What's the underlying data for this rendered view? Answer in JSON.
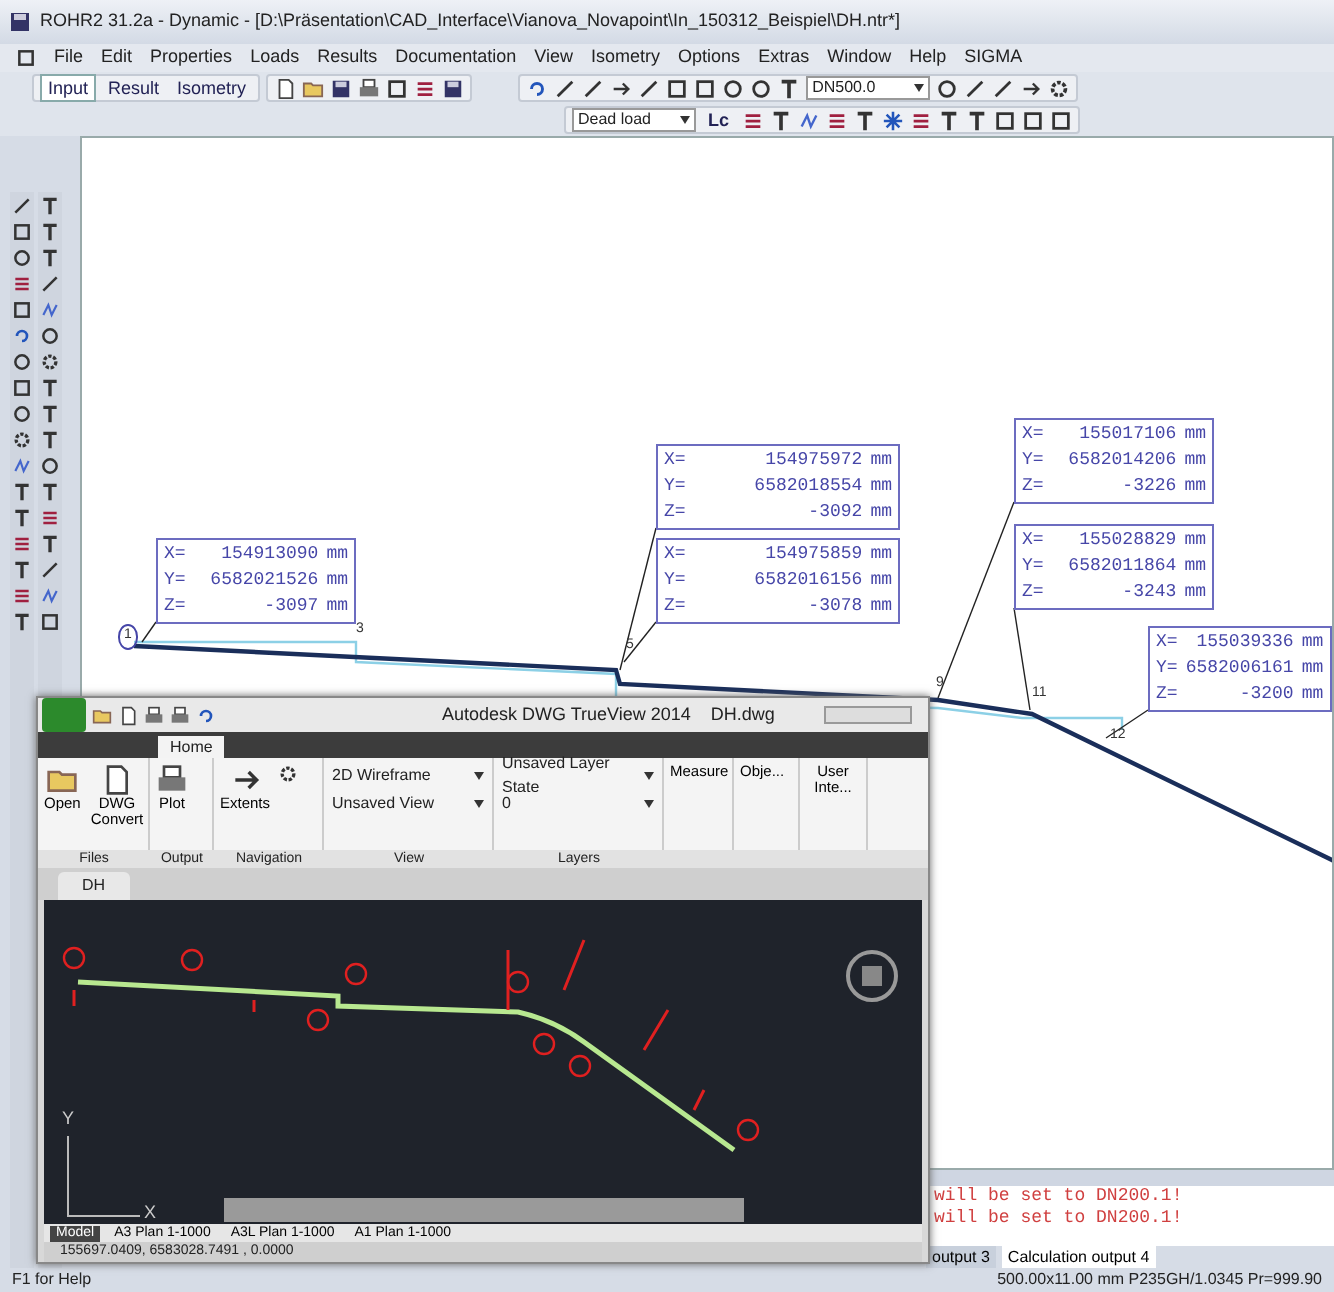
{
  "window": {
    "title": "ROHR2 31.2a - Dynamic - [D:\\Präsentation\\CAD_Interface\\Vianova_Novapoint\\In_150312_Beispiel\\DH.ntr*]"
  },
  "menu": [
    "File",
    "Edit",
    "Properties",
    "Loads",
    "Results",
    "Documentation",
    "View",
    "Isometry",
    "Options",
    "Extras",
    "Window",
    "Help",
    "SIGMA"
  ],
  "mode_tabs": [
    {
      "label": "Input",
      "selected": true
    },
    {
      "label": "Result",
      "selected": false
    },
    {
      "label": "Isometry",
      "selected": false
    }
  ],
  "toolbar": {
    "nominal_diameter": "DN500.0",
    "load_case": "Dead load",
    "load_case_button": "Lc"
  },
  "coordinate_labels": [
    {
      "rows": [
        {
          "axis": "X=",
          "value": "154913090",
          "unit": "mm"
        },
        {
          "axis": "Y=",
          "value": "6582021526",
          "unit": "mm"
        },
        {
          "axis": "Z=",
          "value": "-3097",
          "unit": "mm"
        }
      ]
    },
    {
      "rows": [
        {
          "axis": "X=",
          "value": "154975972",
          "unit": "mm"
        },
        {
          "axis": "Y=",
          "value": "6582018554",
          "unit": "mm"
        },
        {
          "axis": "Z=",
          "value": "-3092",
          "unit": "mm"
        }
      ]
    },
    {
      "rows": [
        {
          "axis": "X=",
          "value": "154975859",
          "unit": "mm"
        },
        {
          "axis": "Y=",
          "value": "6582016156",
          "unit": "mm"
        },
        {
          "axis": "Z=",
          "value": "-3078",
          "unit": "mm"
        }
      ]
    },
    {
      "rows": [
        {
          "axis": "X=",
          "value": "155017106",
          "unit": "mm"
        },
        {
          "axis": "Y=",
          "value": "6582014206",
          "unit": "mm"
        },
        {
          "axis": "Z=",
          "value": "-3226",
          "unit": "mm"
        }
      ]
    },
    {
      "rows": [
        {
          "axis": "X=",
          "value": "155028829",
          "unit": "mm"
        },
        {
          "axis": "Y=",
          "value": "6582011864",
          "unit": "mm"
        },
        {
          "axis": "Z=",
          "value": "-3243",
          "unit": "mm"
        }
      ]
    },
    {
      "rows": [
        {
          "axis": "X=",
          "value": "155039336",
          "unit": "mm"
        },
        {
          "axis": "Y=",
          "value": "6582006161",
          "unit": "mm"
        },
        {
          "axis": "Z=",
          "value": "-3200",
          "unit": "mm"
        }
      ]
    }
  ],
  "node_labels": [
    "1",
    "3",
    "5",
    "9",
    "11",
    "12"
  ],
  "output": {
    "lines": [
      "will be set to DN200.1!",
      "will be set to DN200.1!"
    ],
    "tabs": [
      {
        "label": "output 3",
        "selected": false
      },
      {
        "label": "Calculation output 4",
        "selected": true
      }
    ]
  },
  "status_bar": {
    "help": "F1 for Help",
    "info": "500.00x11.00 mm P235GH/1.0345 Pr=999.90"
  },
  "trueview": {
    "title": "Autodesk DWG TrueView 2014",
    "document": "DH.dwg",
    "ribbon_tabs": [
      {
        "label": "Home",
        "selected": true
      }
    ],
    "buttons": [
      "Open",
      "DWG Convert",
      "Plot",
      "Extents"
    ],
    "dropdowns": [
      "2D Wireframe",
      "Unsaved View",
      "Unsaved Layer State",
      "0"
    ],
    "right_buttons": [
      "Measure",
      "Obje...",
      "User Inte..."
    ],
    "panels": [
      "Files",
      "Output",
      "Navigation",
      "View",
      "Layers"
    ],
    "doc_tab": "DH",
    "ucs": [
      "Y",
      "X"
    ],
    "layout_tabs": [
      {
        "label": "Model",
        "selected": true
      },
      {
        "label": "A3 Plan 1-1000",
        "selected": false
      },
      {
        "label": "A3L Plan 1-1000",
        "selected": false
      },
      {
        "label": "A1 Plan 1-1000",
        "selected": false
      }
    ],
    "coordinates": "155697.0409, 6583028.7491 , 0.0000"
  }
}
